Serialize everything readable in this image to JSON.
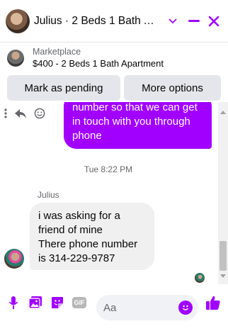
{
  "header": {
    "title": "Julius · 2 Beds 1 Bath Apar…"
  },
  "marketplace": {
    "label": "Marketplace",
    "listing": "$400 - 2 Beds 1 Bath Apartment"
  },
  "actions": {
    "mark_pending": "Mark as pending",
    "more_options": "More options"
  },
  "messages": {
    "outgoing_lines": [
      "number so that we can get",
      "in touch with you through",
      "phone"
    ],
    "timestamp": "Tue 8:22 PM",
    "sender": "Julius",
    "incoming_lines": [
      "i was asking for a",
      "friend of mine",
      "There phone number",
      "is 314-229-9787"
    ]
  },
  "composer": {
    "placeholder": "Aa",
    "gif_label": "GIF"
  },
  "colors": {
    "accent": "#a100ff",
    "button_bg": "#e4e6eb",
    "incoming_bubble": "#f0f0f0"
  },
  "icons": [
    "chevron-down-icon",
    "minimize-icon",
    "close-icon",
    "more-icon",
    "reply-icon",
    "react-icon",
    "microphone-icon",
    "photo-icon",
    "sticker-icon",
    "gif-icon",
    "emoji-icon",
    "thumbs-up-icon"
  ]
}
